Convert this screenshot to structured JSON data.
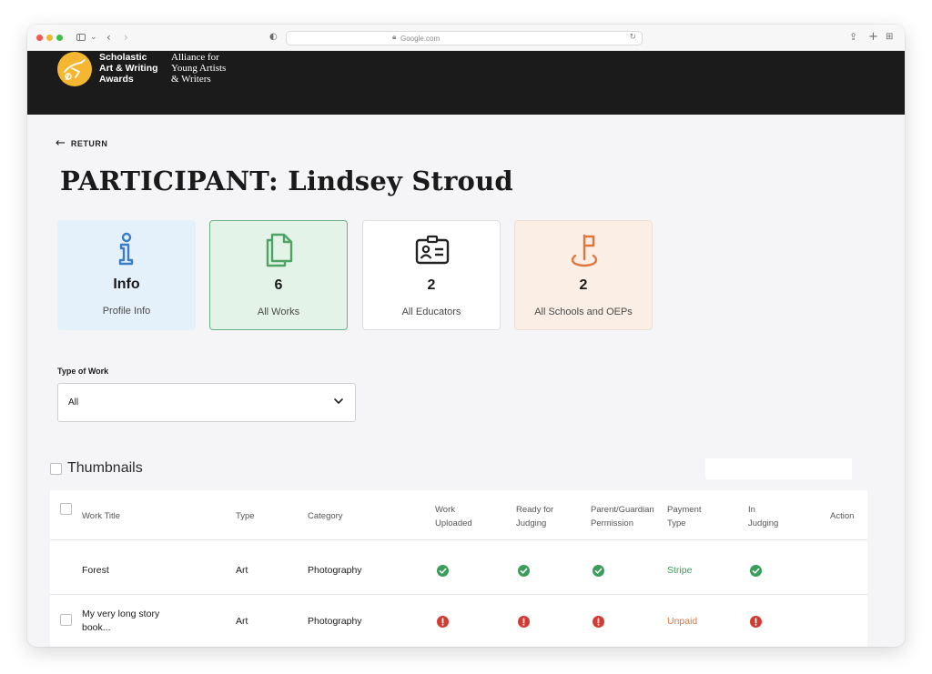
{
  "browser": {
    "url": "Google.com"
  },
  "header": {
    "logo_line1": "Scholastic",
    "logo_line2": "Art & Writing",
    "logo_line3": "Awards",
    "sub_line1": "Alliance for",
    "sub_line2": "Young Artists",
    "sub_line3": "& Writers"
  },
  "return_label": "RETURN",
  "page_title": "PARTICIPANT: Lindsey Stroud",
  "cards": {
    "info": {
      "big": "Info",
      "small": "Profile Info",
      "icon": "info-icon",
      "color": "#3b7cc4"
    },
    "works": {
      "big": "6",
      "small": "All Works",
      "icon": "documents-icon",
      "color": "#4ca364"
    },
    "educators": {
      "big": "2",
      "small": "All Educators",
      "icon": "id-card-icon",
      "color": "#222222"
    },
    "schools": {
      "big": "2",
      "small": "All Schools and OEPs",
      "icon": "location-flag-icon",
      "color": "#e0763e"
    }
  },
  "filter": {
    "label": "Type of Work",
    "value": "All"
  },
  "thumbnails_label": "Thumbnails",
  "table": {
    "headers": {
      "work_title": "Work Title",
      "type": "Type",
      "category": "Category",
      "uploaded_1": "Work",
      "uploaded_2": "Uploaded",
      "ready_1": "Ready for",
      "ready_2": "Judging",
      "permission_1": "Parent/Guardian",
      "permission_2": "Permission",
      "payment_1": "Payment",
      "payment_2": "Type",
      "judging_1": "In",
      "judging_2": "Judging",
      "action": "Action"
    },
    "rows": [
      {
        "title_1": "Forest",
        "title_2": "",
        "type": "Art",
        "category": "Photography",
        "uploaded": "ok",
        "ready": "ok",
        "permission": "ok",
        "payment": "Stripe",
        "in_judging": "ok"
      },
      {
        "title_1": "My very long story",
        "title_2": "book...",
        "type": "Art",
        "category": "Photography",
        "uploaded": "error",
        "ready": "error",
        "permission": "error",
        "payment": "Unpaid",
        "in_judging": "error"
      }
    ]
  },
  "colors": {
    "ok": "#3a9d59",
    "error": "#d33a32",
    "paid": "#3a9d59",
    "unpaid": "#e0763e"
  }
}
